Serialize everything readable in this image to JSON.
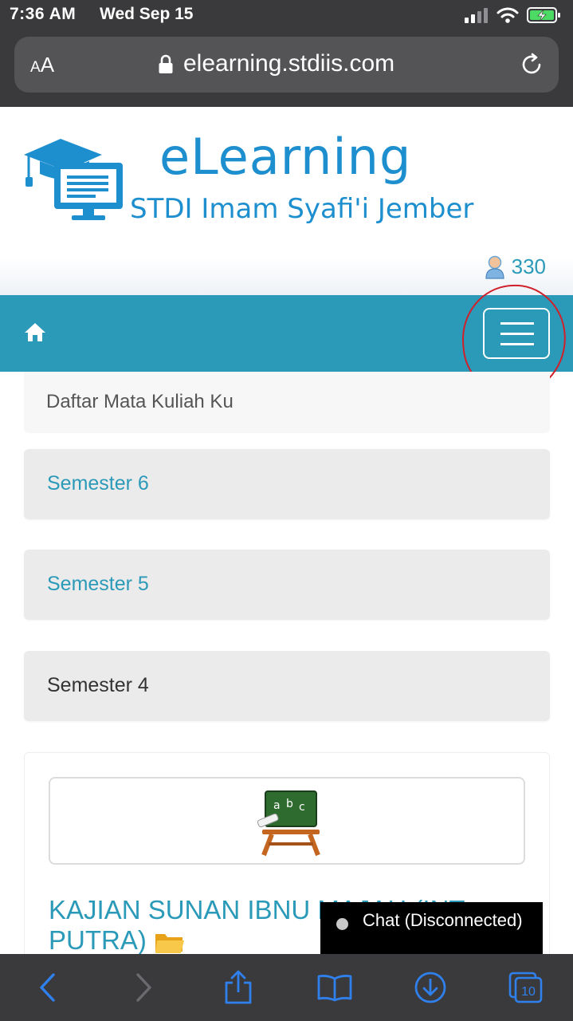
{
  "status_bar": {
    "time": "7:36 AM",
    "date": "Wed Sep 15"
  },
  "browser": {
    "aa_label_small": "A",
    "aa_label_large": "A",
    "url": "elearning.stdiis.com",
    "tab_count": "10"
  },
  "header": {
    "brand_title": "eLearning",
    "brand_subtitle": "STDI Imam Syafi'i Jember",
    "online_count": "330"
  },
  "breadcrumb": {
    "label": "Daftar Mata Kuliah Ku"
  },
  "semesters": [
    {
      "label": "Semester 6"
    },
    {
      "label": "Semester 5"
    },
    {
      "label": "Semester 4"
    }
  ],
  "course_card": {
    "title": "KAJIAN SUNAN IBNU MAJAH (INT. PUTRA)"
  },
  "chat": {
    "label": "Chat (Disconnected)",
    "status_color": "#c8c8c8"
  },
  "colors": {
    "accent": "#2b9ab9",
    "brand": "#1d8fcf",
    "annotation": "#d0202a"
  }
}
